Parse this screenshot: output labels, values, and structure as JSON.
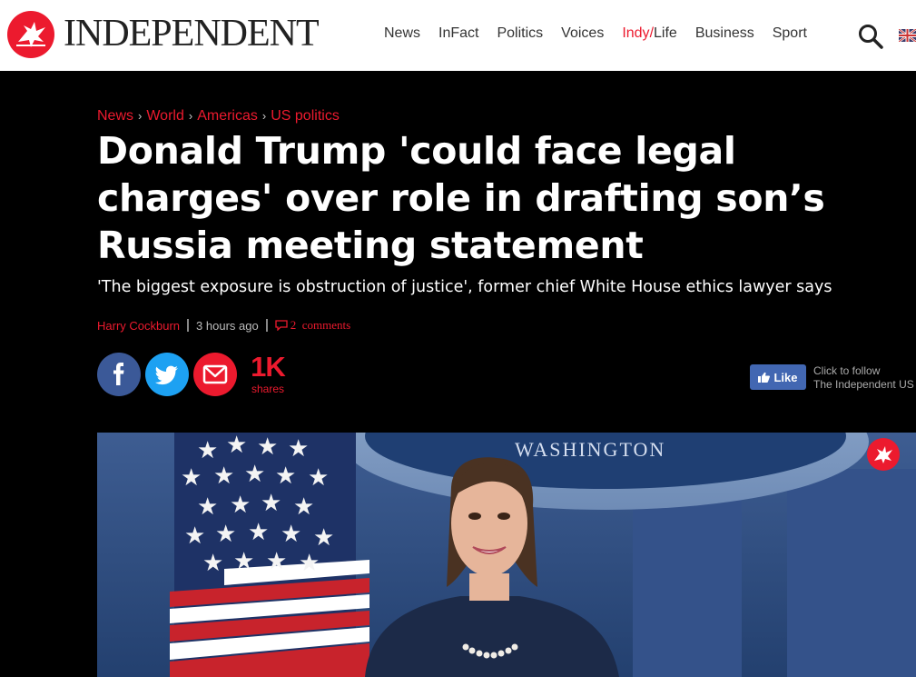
{
  "header": {
    "logo_text": "INDEPENDENT",
    "nav": [
      "News",
      "InFact",
      "Politics",
      "Voices",
      "Indy/Life",
      "Business",
      "Sport"
    ],
    "nav_indy_a": "Indy",
    "nav_indy_slash": "/",
    "nav_indy_b": "Life"
  },
  "article": {
    "breadcrumb": [
      "News",
      "World",
      "Americas",
      "US politics"
    ],
    "breadcrumb_sep": "›",
    "headline": "Donald Trump 'could face legal charges' over role in drafting son’s Russia meeting statement",
    "standfirst": "'The biggest exposure is obstruction of justice', former chief White House ethics lawyer says",
    "author": "Harry Cockburn",
    "time": "3 hours ago",
    "comments_count": "2",
    "comments_label": "comments",
    "shares_count": "1K",
    "shares_label": "shares",
    "like_label": "Like",
    "follow_line1": "Click to follow",
    "follow_line2": "The Independent US"
  },
  "photo": {
    "podium_text": "WASHINGTON"
  },
  "colors": {
    "brand_red": "#ec1a2e",
    "facebook_blue": "#3b5998",
    "twitter_blue": "#1da1f2",
    "like_blue": "#4267b2"
  }
}
